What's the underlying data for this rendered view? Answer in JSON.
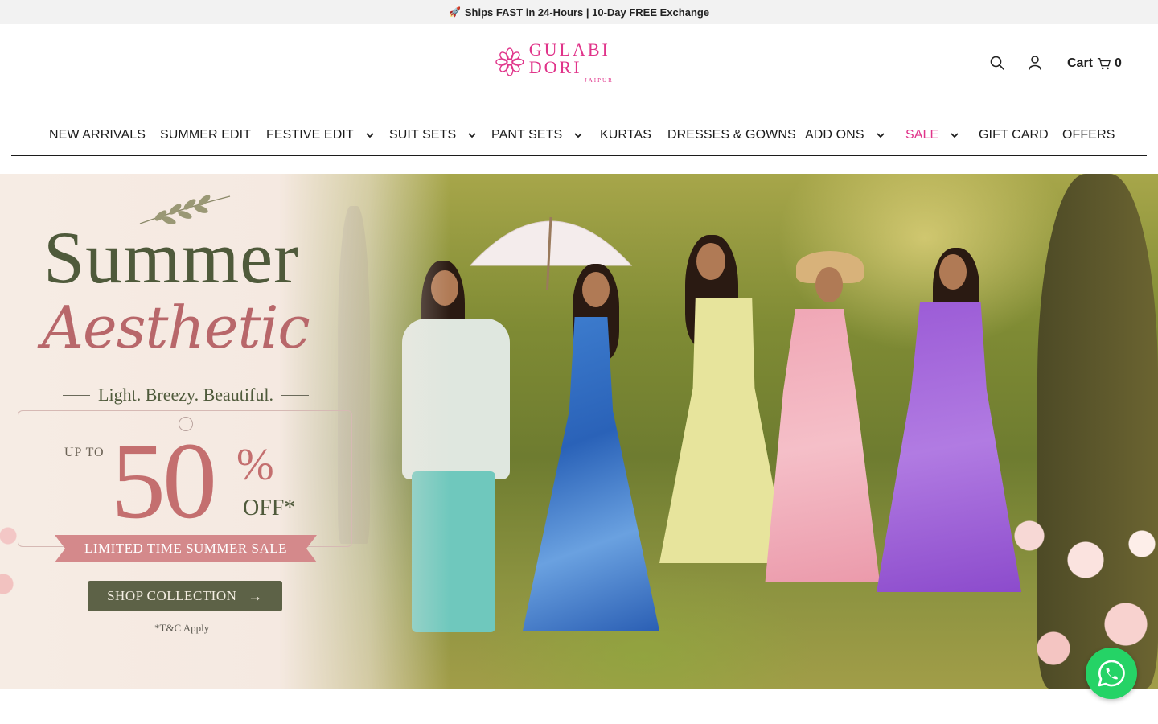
{
  "announcement": {
    "icon": "rocket-icon",
    "text": "Ships FAST in 24-Hours | 10-Day FREE Exchange"
  },
  "header": {
    "logo": {
      "name": "GULABI DORI",
      "place": "JAIPUR",
      "color": "#e0348a"
    },
    "cart": {
      "label": "Cart",
      "count": "0"
    },
    "icons": [
      "search-icon",
      "account-icon",
      "cart-icon"
    ]
  },
  "nav": {
    "items": [
      {
        "label": "NEW ARRIVALS",
        "has_dropdown": false
      },
      {
        "label": "SUMMER EDIT",
        "has_dropdown": false
      },
      {
        "label": "FESTIVE EDIT",
        "has_dropdown": true
      },
      {
        "label": "SUIT SETS",
        "has_dropdown": true
      },
      {
        "label": "PANT SETS",
        "has_dropdown": true
      },
      {
        "label": "KURTAS",
        "has_dropdown": false
      },
      {
        "label": "DRESSES & GOWNS",
        "has_dropdown": false
      },
      {
        "label": "ADD ONS",
        "has_dropdown": true
      },
      {
        "label": "SALE",
        "has_dropdown": true,
        "color": "#e0348a"
      },
      {
        "label": "GIFT CARD",
        "has_dropdown": false
      },
      {
        "label": "OFFERS",
        "has_dropdown": false
      }
    ]
  },
  "hero": {
    "title": "Summer",
    "subtitle": "Aesthetic",
    "tagline": "Light. Breezy. Beautiful.",
    "upto": "UP TO",
    "discount": "50",
    "percent": "%",
    "off": "OFF*",
    "banner": "LIMITED TIME SUMMER SALE",
    "cta": "SHOP COLLECTION",
    "terms": "*T&C Apply"
  },
  "whatsapp": {
    "icon": "whatsapp-icon",
    "color": "#25d366"
  }
}
